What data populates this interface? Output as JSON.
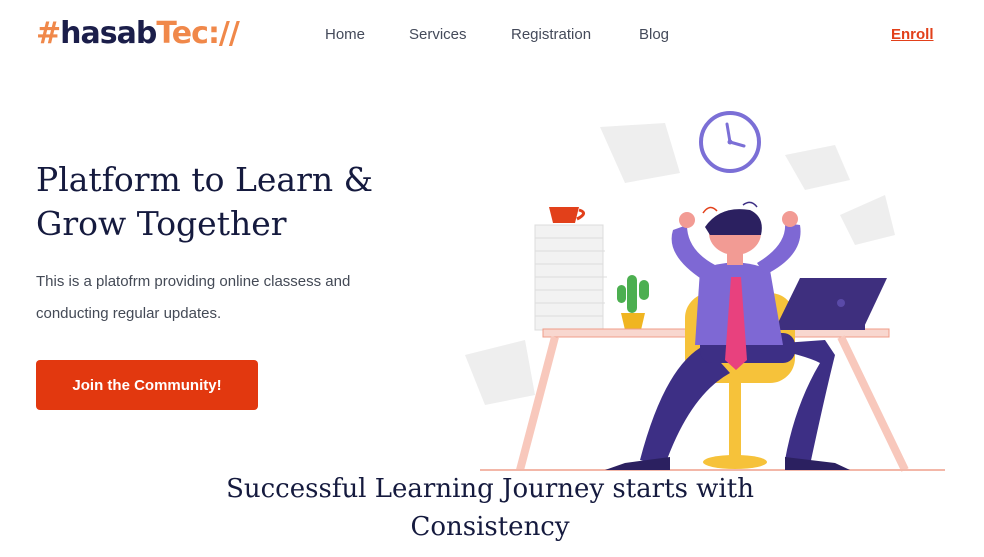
{
  "brand": {
    "hash": "#",
    "mid": "hasab",
    "tec": "Tec://"
  },
  "nav": {
    "items": [
      {
        "label": "Home"
      },
      {
        "label": "Services"
      },
      {
        "label": "Registration"
      },
      {
        "label": "Blog"
      }
    ],
    "enroll": "Enroll"
  },
  "hero": {
    "title": "Platform to Learn & Grow Together",
    "description": "This is a platofrm providing online classess and conducting regular updates.",
    "cta": "Join the Community!"
  },
  "section": {
    "title": "Successful Learning Journey starts with Consistency"
  },
  "colors": {
    "accent": "#e2380f",
    "brand_orange": "#f0884a",
    "navy": "#1b1e4a",
    "purple": "#4b3a8c"
  }
}
